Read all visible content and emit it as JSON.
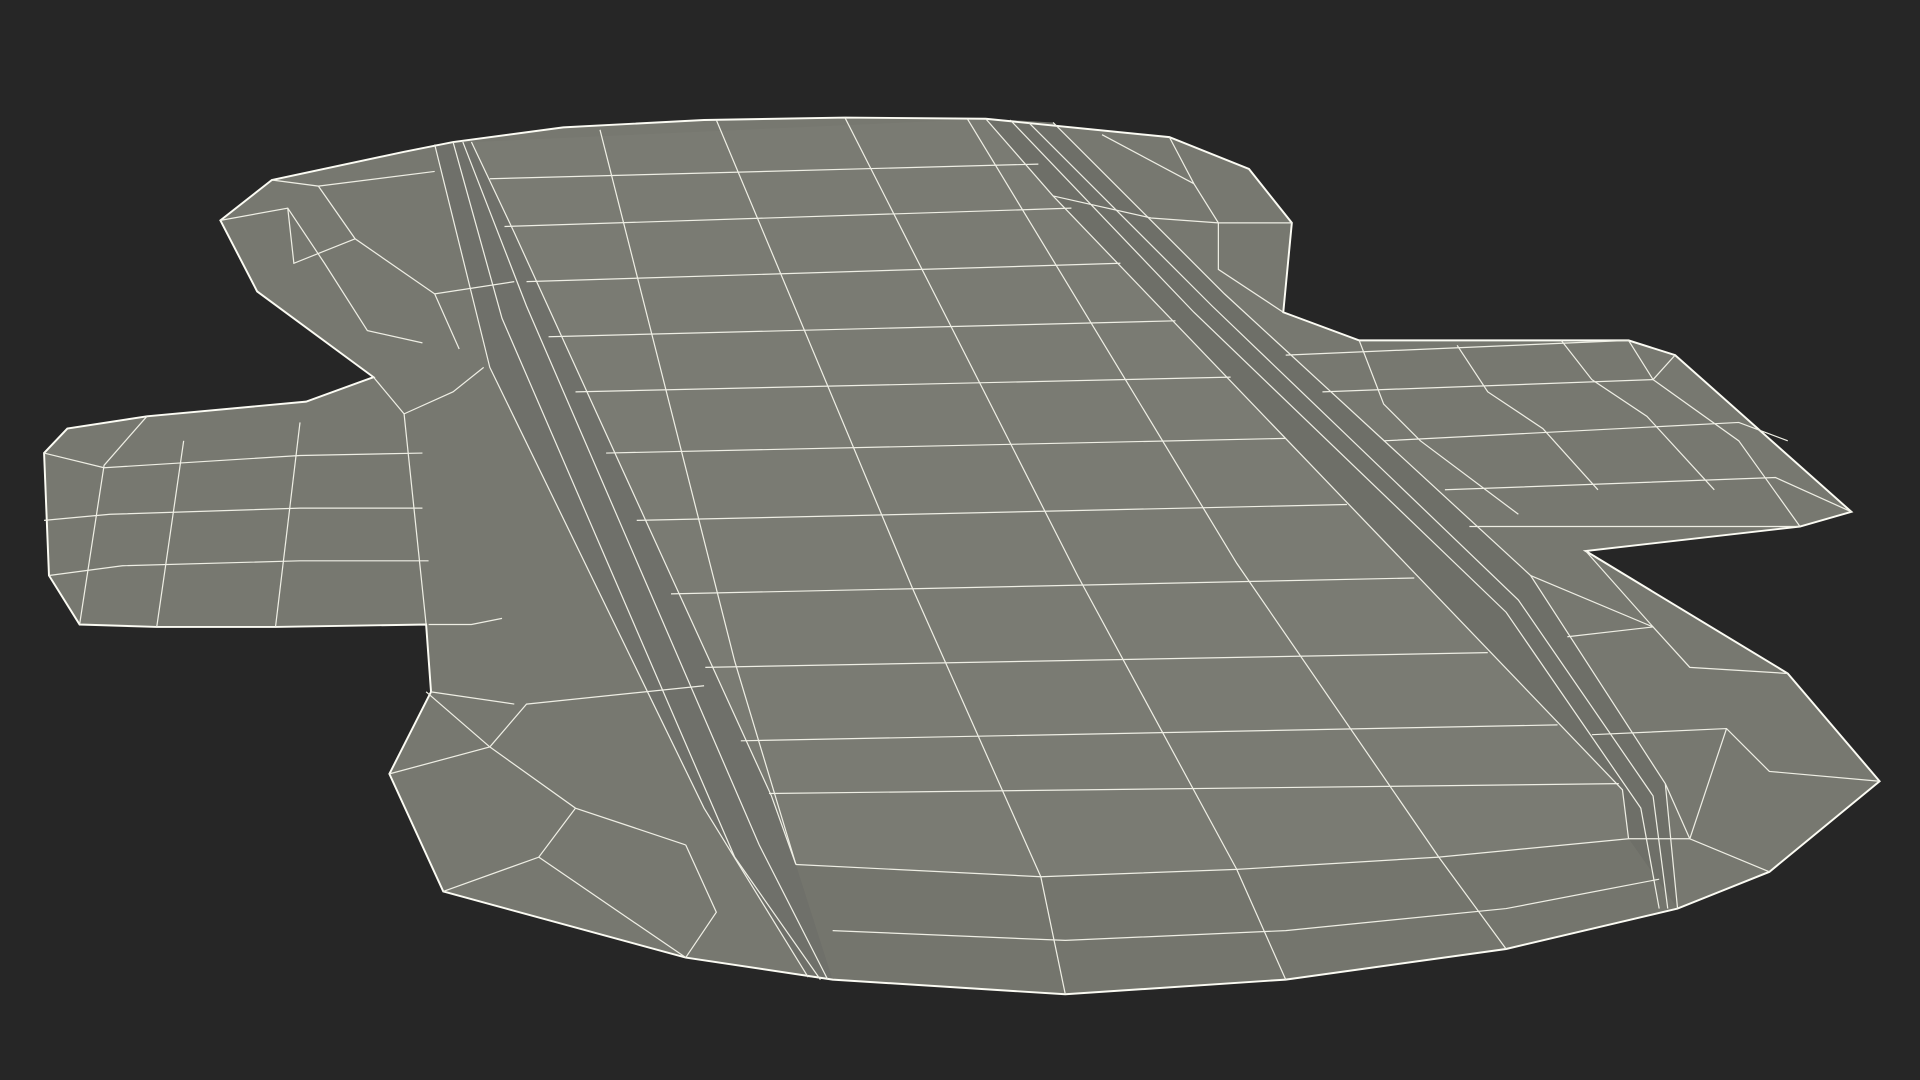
{
  "scene": {
    "subject": "wireframe-mesh",
    "colors": {
      "background": "#262626",
      "surface": "#777870",
      "surface_dark": "#6a6b63",
      "surface_light": "#84857c",
      "wire": "#f0f0e6",
      "edge": "#fbfbf3"
    }
  }
}
